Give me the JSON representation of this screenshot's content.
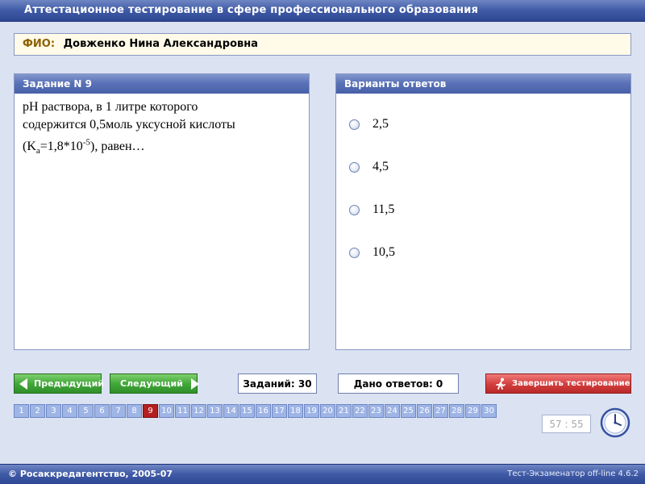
{
  "app": {
    "title": "Аттестационное тестирование в сфере профессионального образования"
  },
  "fio": {
    "label": "ФИО:",
    "name": "Довженко Нина Александровна"
  },
  "task_panel": {
    "header": "Задание N 9",
    "question": {
      "line1": "pH раствора, в 1 литре которого",
      "line2": "содержится 0,5моль уксусной кислоты",
      "part_open": "(K",
      "sub": "a",
      "part_mid": "=1,8*10",
      "sup": "-5",
      "part_end": "), равен…"
    }
  },
  "answers_panel": {
    "header": "Варианты ответов",
    "options": [
      "2,5",
      "4,5",
      "11,5",
      "10,5"
    ]
  },
  "controls": {
    "prev_label": "Предыдущий",
    "next_label": "Следующий",
    "tasks_count": "Заданий: 30",
    "answers_given": "Дано ответов: 0",
    "finish_label": "Завершить тестирование",
    "current_page": 9,
    "pages": [
      "1",
      "2",
      "3",
      "4",
      "5",
      "6",
      "7",
      "8",
      "9",
      "10",
      "11",
      "12",
      "13",
      "14",
      "15",
      "16",
      "17",
      "18",
      "19",
      "20",
      "21",
      "22",
      "23",
      "24",
      "25",
      "26",
      "27",
      "28",
      "29",
      "30"
    ]
  },
  "timer": "57 : 55",
  "footer": {
    "copyright": "© Росаккредагентство, 2005-07",
    "version": "Тест-Экзаменатор off-line 4.6.2"
  },
  "colors": {
    "title_bar": "#3f5aa6",
    "page_current": "#b41f1f",
    "page_default": "#9fb5e6",
    "nav_green": "#43a83a",
    "finish_red": "#d54141"
  },
  "icons": {
    "prev": "arrow-left-icon",
    "next": "arrow-right-icon",
    "finish": "running-man-icon",
    "clock": "clock-icon",
    "radio": "radio-button"
  }
}
